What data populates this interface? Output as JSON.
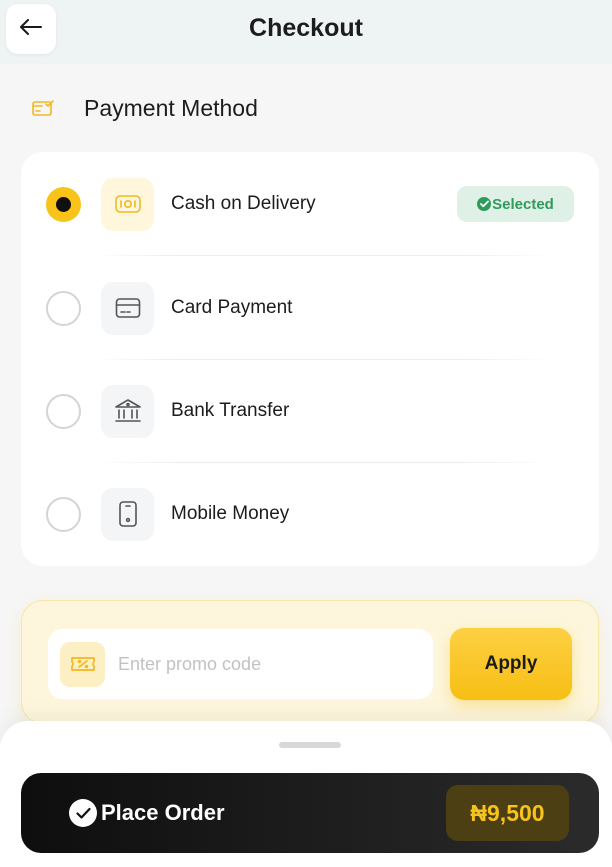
{
  "header": {
    "title": "Checkout",
    "back_icon": "arrow-left-icon"
  },
  "payment_section": {
    "title": "Payment Method",
    "icon": "payment-card-check-icon",
    "methods": [
      {
        "label": "Cash on Delivery",
        "icon": "cash-icon",
        "selected": true,
        "badge": "Selected"
      },
      {
        "label": "Card Payment",
        "icon": "credit-card-icon",
        "selected": false
      },
      {
        "label": "Bank Transfer",
        "icon": "bank-icon",
        "selected": false
      },
      {
        "label": "Mobile Money",
        "icon": "mobile-phone-icon",
        "selected": false
      }
    ]
  },
  "promo": {
    "placeholder": "Enter promo code",
    "value": "",
    "icon": "ticket-icon",
    "apply_label": "Apply"
  },
  "footer": {
    "place_order_label": "Place Order",
    "total": "₦9,500"
  },
  "colors": {
    "accent": "#f9c31a",
    "success": "#2f9b5b",
    "dark": "#111111"
  }
}
